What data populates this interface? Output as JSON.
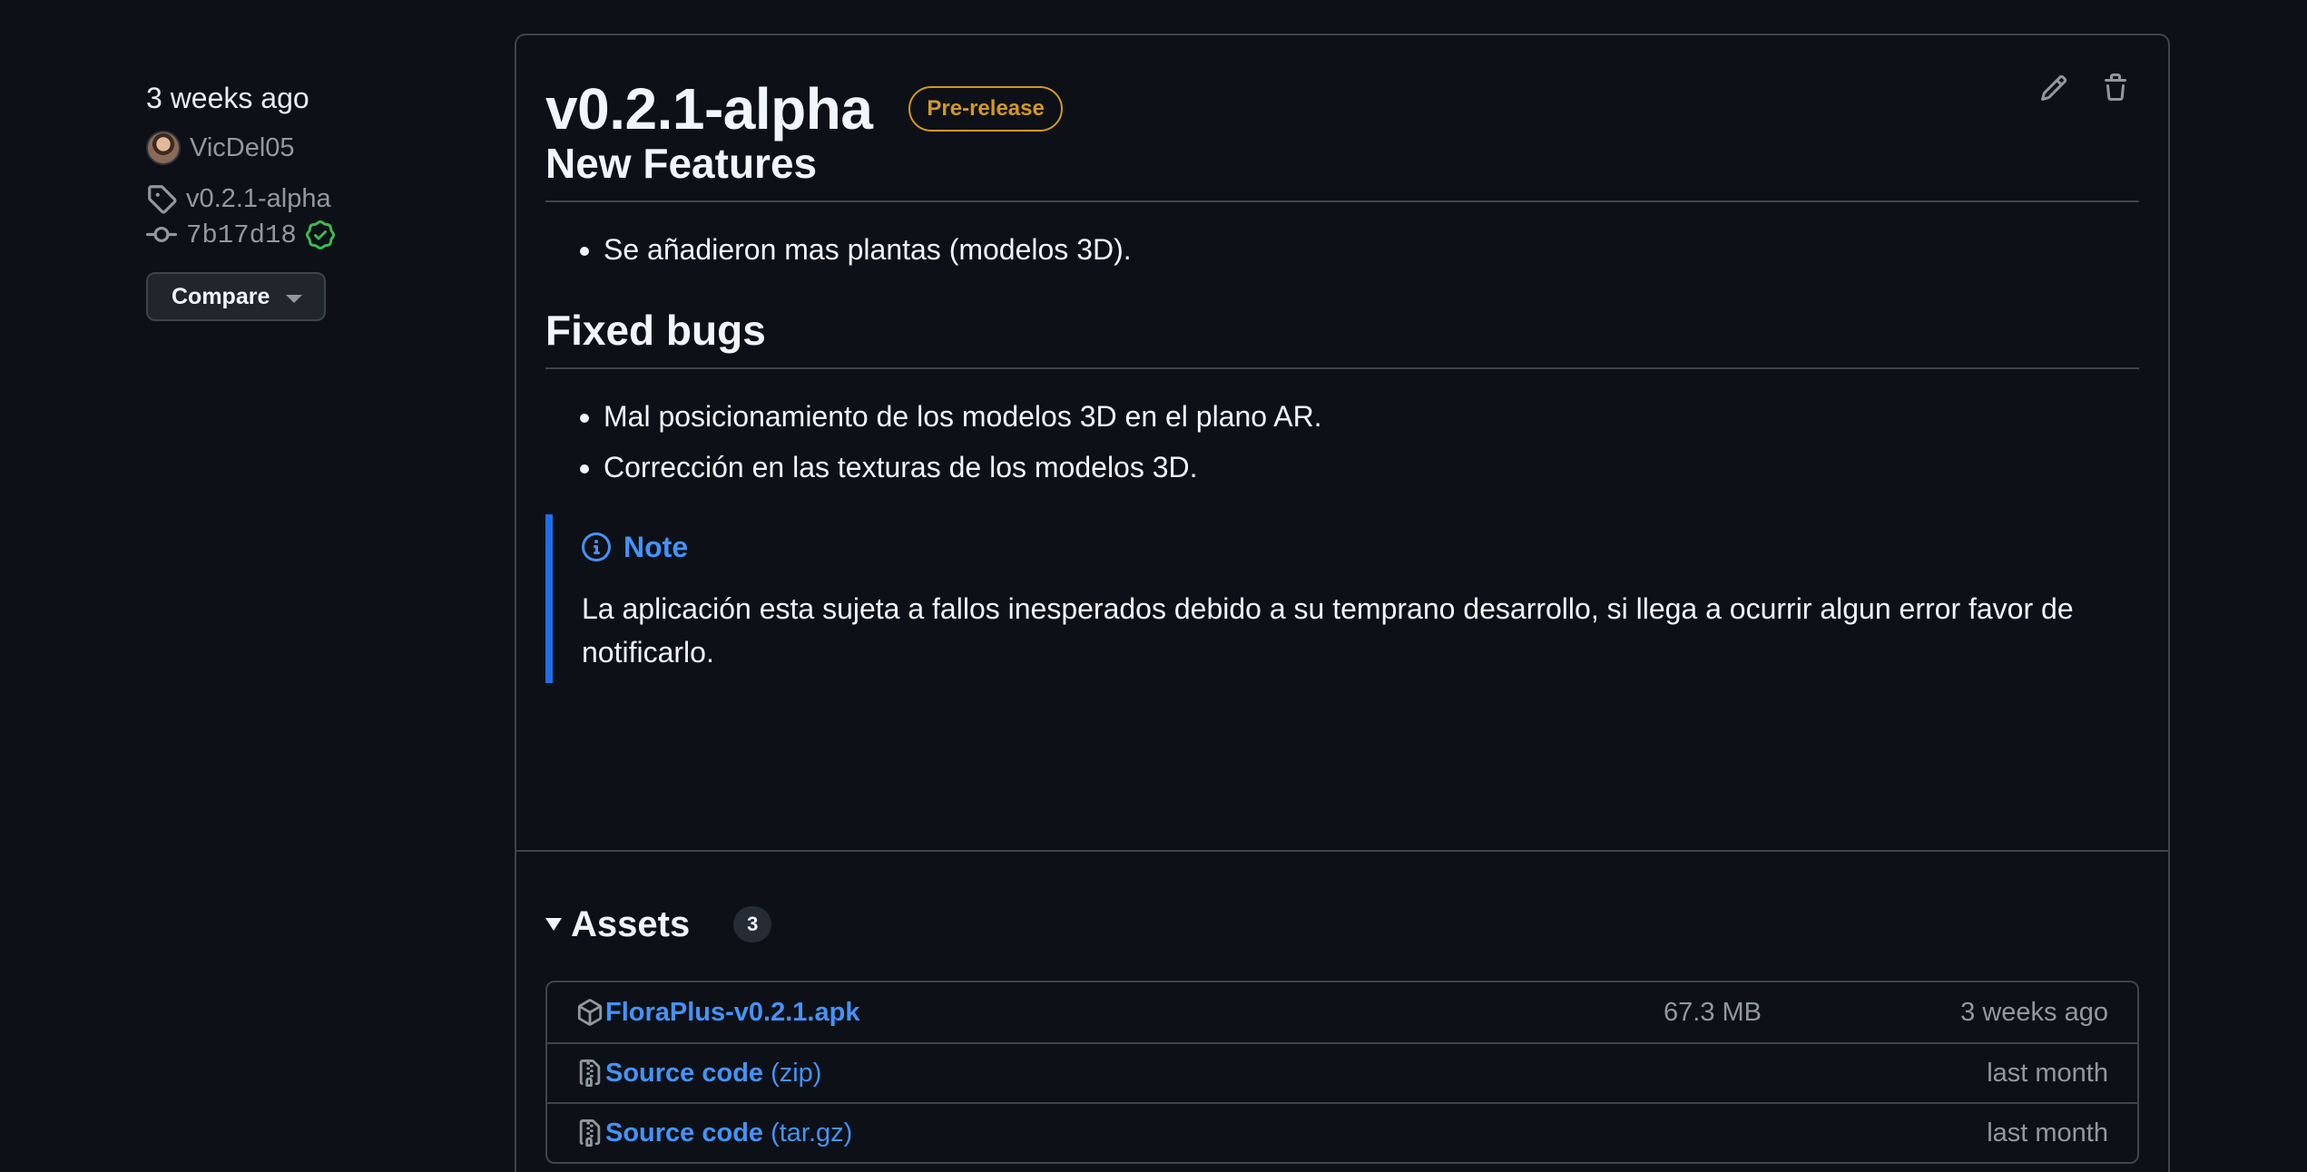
{
  "sidebar": {
    "date": "3 weeks ago",
    "author": "VicDel05",
    "tag": "v0.2.1-alpha",
    "commit": "7b17d18",
    "compare_label": "Compare"
  },
  "release": {
    "title": "v0.2.1-alpha",
    "badge": "Pre-release",
    "sections": [
      {
        "heading": "New Features",
        "items": [
          "Se añadieron mas plantas (modelos 3D)."
        ]
      },
      {
        "heading": "Fixed bugs",
        "items": [
          "Mal posicionamiento de los modelos 3D en el plano AR.",
          "Corrección en las texturas de los modelos 3D."
        ]
      }
    ],
    "note": {
      "title": "Note",
      "text": "La aplicación esta sujeta a fallos inesperados debido a su temprano desarrollo, si llega a ocurrir algun error favor de notificarlo."
    }
  },
  "assets": {
    "title": "Assets",
    "count": "3",
    "rows": [
      {
        "name": "FloraPlus-v0.2.1.apk",
        "ext": "",
        "size": "67.3 MB",
        "date": "3 weeks ago",
        "icon": "package-icon"
      },
      {
        "name": "Source code",
        "ext": "(zip)",
        "size": "",
        "date": "last month",
        "icon": "file-zip-icon"
      },
      {
        "name": "Source code",
        "ext": "(tar.gz)",
        "size": "",
        "date": "last month",
        "icon": "file-zip-icon"
      }
    ]
  },
  "colors": {
    "background": "#0d1117",
    "link": "#4493f8",
    "prerelease": "#d29922",
    "verified": "#3fb950",
    "note_border": "#1f6feb"
  }
}
